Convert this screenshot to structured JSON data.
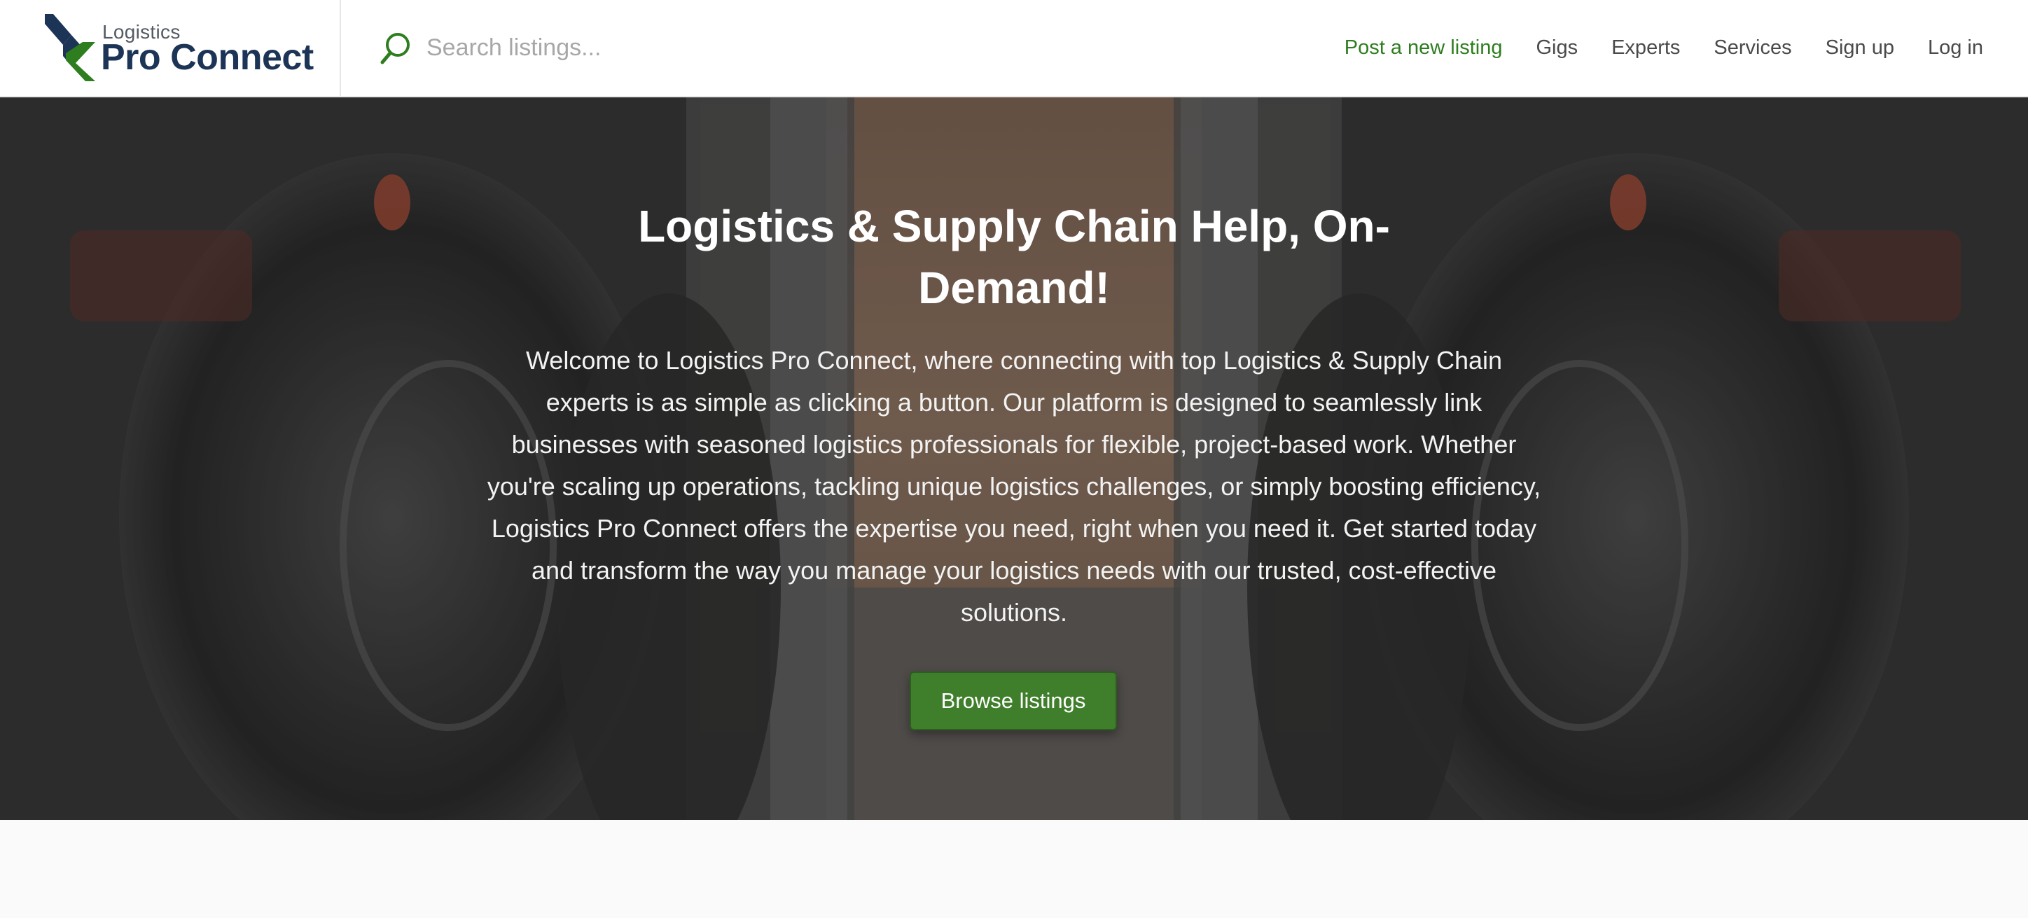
{
  "brand": {
    "small_text": "Logistics",
    "big_text": "Pro Connect",
    "colors": {
      "navy": "#1c3456",
      "green": "#2e7d1f"
    }
  },
  "search": {
    "placeholder": "Search listings...",
    "value": "",
    "icon": "search-icon"
  },
  "nav": {
    "post_listing": "Post a new listing",
    "gigs": "Gigs",
    "experts": "Experts",
    "services": "Services",
    "sign_up": "Sign up",
    "log_in": "Log in"
  },
  "hero": {
    "title": "Logistics & Supply Chain Help, On-Demand!",
    "text": "Welcome to Logistics Pro Connect, where connecting with top Logistics & Supply Chain experts is as simple as clicking a button. Our platform is designed to seamlessly link businesses with seasoned logistics professionals for flexible, project-based work. Whether you're scaling up operations, tackling unique logistics challenges, or simply boosting efficiency, Logistics Pro Connect offers the expertise you need, right when you need it. Get started today and transform the way you manage your logistics needs with our trusted, cost-effective solutions.",
    "button_label": "Browse listings",
    "button_color": "#3f7f2b"
  }
}
